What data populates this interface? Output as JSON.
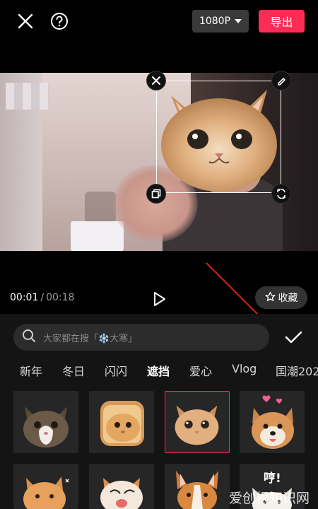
{
  "topbar": {
    "resolution": "1080P",
    "export_label": "导出"
  },
  "player": {
    "current_time": "00:01",
    "separator": "/",
    "total_time": "00:18",
    "favorite_label": "收藏"
  },
  "search": {
    "placeholder": "大家都在搜「❄️大寒」"
  },
  "categories": [
    "新年",
    "冬日",
    "闪闪",
    "遮挡",
    "爱心",
    "Vlog",
    "国潮202"
  ],
  "active_category": "遮挡",
  "colors": {
    "accent": "#fe2c55",
    "panel": "#141414",
    "tile": "#262626"
  },
  "stickers_row1": [
    "cat-sticker",
    "cat-toast-sticker",
    "cat-face-sticker",
    "shiba-hearts-sticker"
  ],
  "stickers_row2": [
    "cat-sticker-2",
    "dog-sticker",
    "corgi-sticker",
    "dog-text-sticker"
  ],
  "sticker_texts": {
    "dog_text": "哼!"
  },
  "watermark": "爱创根知识网"
}
